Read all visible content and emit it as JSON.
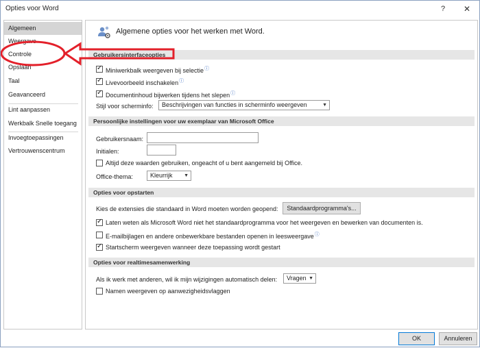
{
  "window": {
    "title": "Opties voor Word",
    "help_glyph": "?",
    "close_glyph": "✕"
  },
  "sidebar": {
    "items": [
      {
        "label": "Algemeen",
        "selected": true
      },
      {
        "label": "Weergave"
      },
      {
        "label": "Controle"
      },
      {
        "label": "Opslaan"
      },
      {
        "label": "Taal"
      },
      {
        "label": "Geavanceerd"
      },
      {
        "label": "Lint aanpassen"
      },
      {
        "label": "Werkbalk Snelle toegang"
      },
      {
        "label": "Invoegtoepassingen"
      },
      {
        "label": "Vertrouwenscentrum"
      }
    ]
  },
  "content": {
    "header": "Algemene opties voor het werken met Word.",
    "ui_section": {
      "title": "Gebruikersinterfaceopties",
      "options": [
        {
          "label": "Miniwerkbalk weergeven bij selectie",
          "checked": true,
          "info": "ⓘ"
        },
        {
          "label": "Livevoorbeeld inschakelen",
          "checked": true,
          "info": "ⓘ"
        },
        {
          "label": "Documentinhoud bijwerken tijdens het slepen",
          "checked": true,
          "info": "ⓘ"
        }
      ],
      "screentip_label": "Stijl voor scherminfo:",
      "screentip_value": "Beschrijvingen van functies in scherminfo weergeven"
    },
    "personal_section": {
      "title": "Persoonlijke instellingen voor uw exemplaar van Microsoft Office",
      "username_label": "Gebruikersnaam:",
      "username_value": "",
      "initials_label": "Initialen:",
      "initials_value": "",
      "always_use_label": "Altijd deze waarden gebruiken, ongeacht of u bent aangemeld bij Office.",
      "always_use_checked": false,
      "theme_label": "Office-thema:",
      "theme_value": "Kleurrijk"
    },
    "startup_section": {
      "title": "Opties voor opstarten",
      "extensions_label": "Kies de extensies die standaard in Word moeten worden geopend:",
      "default_programs_button": "Standaardprogramma's...",
      "options": [
        {
          "label": "Laten weten als Microsoft Word niet het standaardprogramma voor het weergeven en bewerken van documenten is.",
          "checked": true
        },
        {
          "label": "E-mailbijlagen en andere onbewerkbare bestanden openen in leesweergave",
          "checked": false,
          "info": "ⓘ"
        },
        {
          "label": "Startscherm weergeven wanneer deze toepassing wordt gestart",
          "checked": true
        }
      ]
    },
    "collab_section": {
      "title": "Opties voor realtimesamenwerking",
      "share_label": "Als ik werk met anderen, wil ik mijn wijzigingen automatisch delen:",
      "share_value": "Vragen",
      "show_names_label": "Namen weergeven op aanwezigheidsvlaggen",
      "show_names_checked": false
    }
  },
  "footer": {
    "ok_label": "OK",
    "cancel_label": "Annuleren"
  },
  "colors": {
    "annotation_red": "#e3202a",
    "selected_nav": "#d5d5d5",
    "section_bg": "#e6e6e6"
  }
}
